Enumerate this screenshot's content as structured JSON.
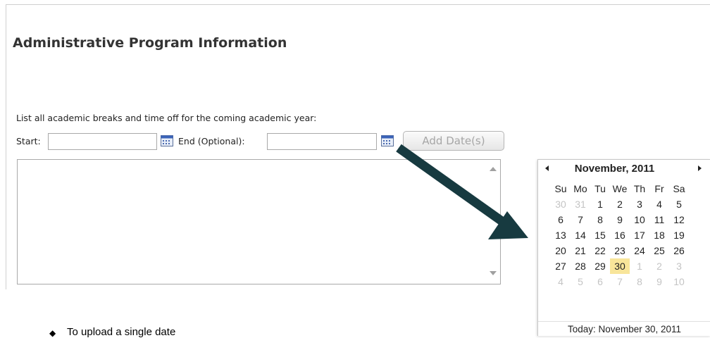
{
  "page": {
    "title": "Administrative Program Information",
    "instructions": "List all academic breaks and time off for the coming academic year:"
  },
  "form": {
    "start_label": "Start:",
    "start_value": "",
    "end_label": "End (Optional):",
    "end_value": "",
    "add_button_label": "Add Date(s)",
    "breaks_list_value": ""
  },
  "calendar": {
    "month_label": "November, 2011",
    "day_headers": [
      "Su",
      "Mo",
      "Tu",
      "We",
      "Th",
      "Fr",
      "Sa"
    ],
    "weeks": [
      [
        {
          "d": "30",
          "o": true
        },
        {
          "d": "31",
          "o": true
        },
        {
          "d": "1"
        },
        {
          "d": "2"
        },
        {
          "d": "3"
        },
        {
          "d": "4"
        },
        {
          "d": "5"
        }
      ],
      [
        {
          "d": "6"
        },
        {
          "d": "7"
        },
        {
          "d": "8"
        },
        {
          "d": "9"
        },
        {
          "d": "10"
        },
        {
          "d": "11"
        },
        {
          "d": "12"
        }
      ],
      [
        {
          "d": "13"
        },
        {
          "d": "14"
        },
        {
          "d": "15"
        },
        {
          "d": "16"
        },
        {
          "d": "17"
        },
        {
          "d": "18"
        },
        {
          "d": "19"
        }
      ],
      [
        {
          "d": "20"
        },
        {
          "d": "21"
        },
        {
          "d": "22"
        },
        {
          "d": "23"
        },
        {
          "d": "24"
        },
        {
          "d": "25"
        },
        {
          "d": "26"
        }
      ],
      [
        {
          "d": "27"
        },
        {
          "d": "28"
        },
        {
          "d": "29"
        },
        {
          "d": "30",
          "sel": true
        },
        {
          "d": "1",
          "o": true
        },
        {
          "d": "2",
          "o": true
        },
        {
          "d": "3",
          "o": true
        }
      ],
      [
        {
          "d": "4",
          "o": true
        },
        {
          "d": "5",
          "o": true
        },
        {
          "d": "6",
          "o": true
        },
        {
          "d": "7",
          "o": true
        },
        {
          "d": "8",
          "o": true
        },
        {
          "d": "9",
          "o": true
        },
        {
          "d": "10",
          "o": true
        }
      ]
    ],
    "today_label": "Today: November 30, 2011",
    "selected_color": "#f8e59a"
  },
  "note": {
    "bullet_glyph": "◆",
    "text": "To upload a single date"
  },
  "annotation": {
    "arrow_color": "#173a40"
  }
}
